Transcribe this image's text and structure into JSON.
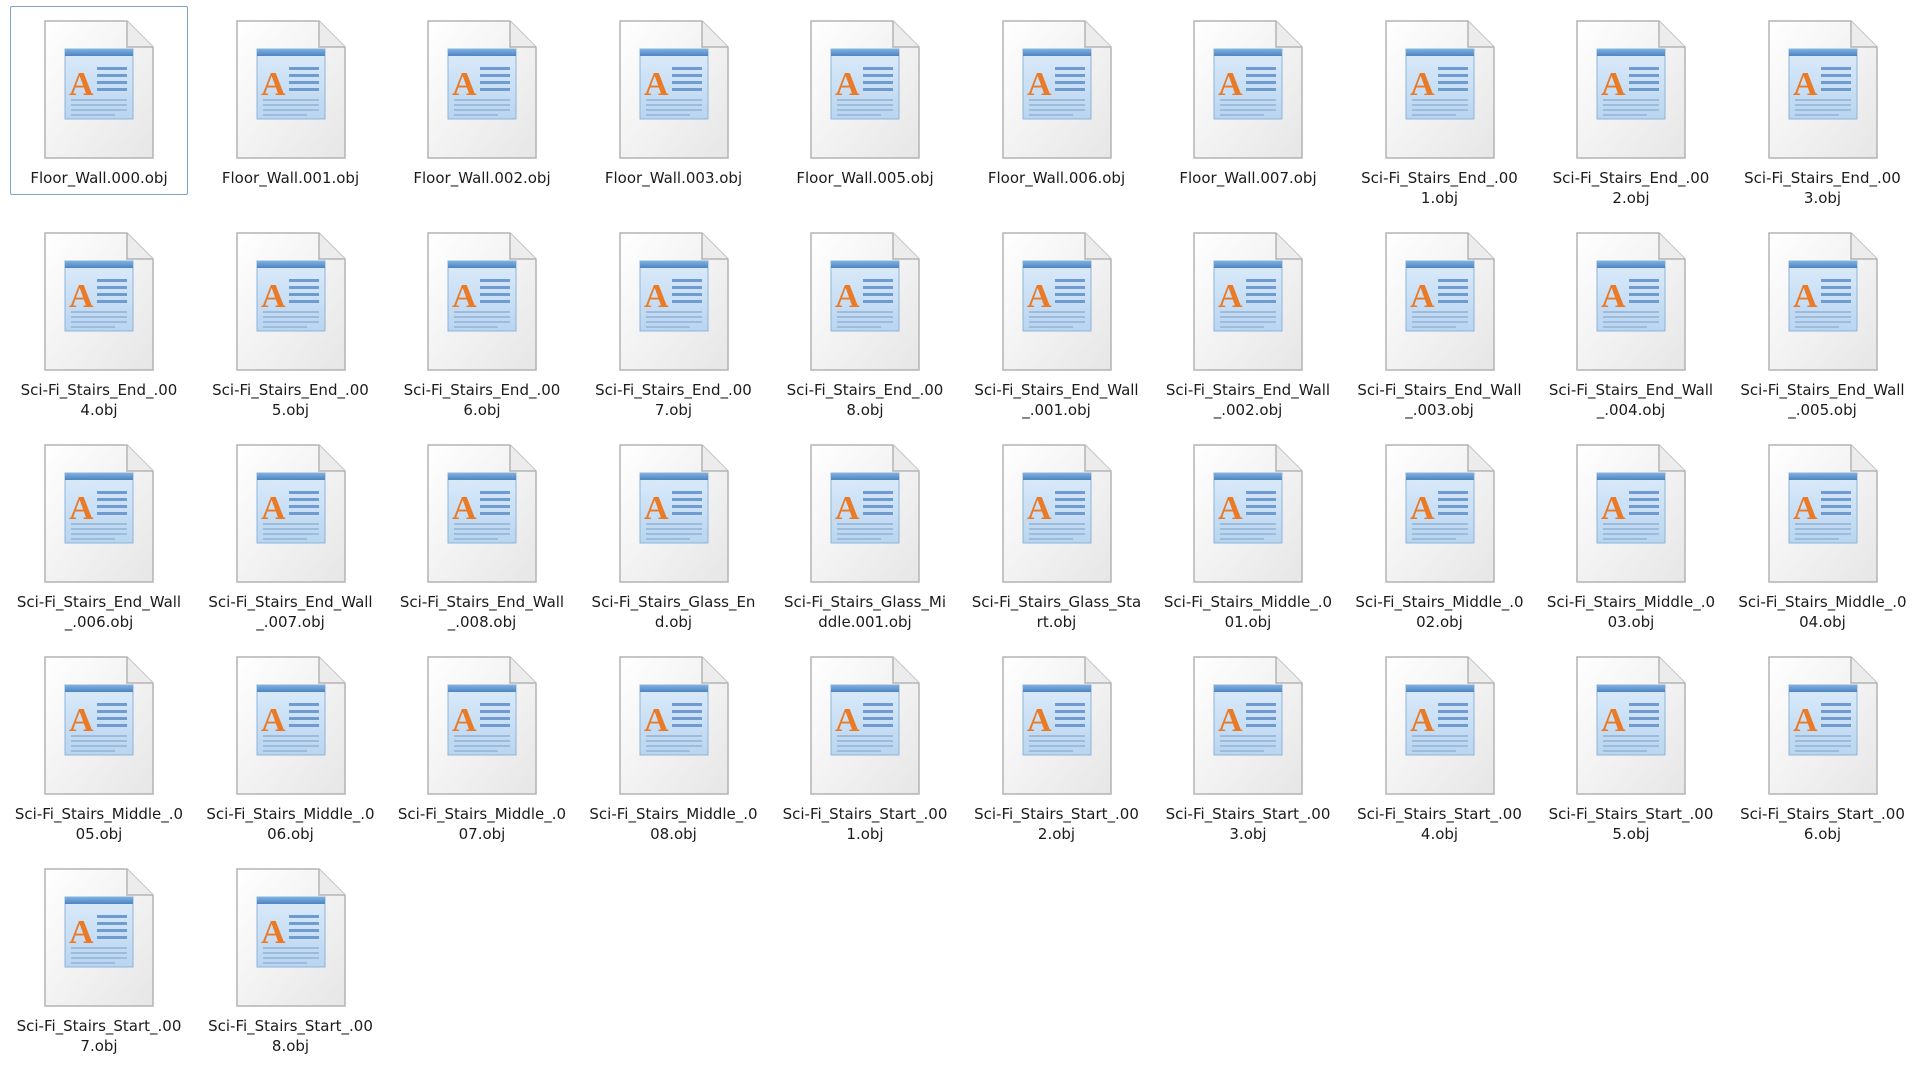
{
  "explorer": {
    "icon": "wordpad-document-icon",
    "files": [
      {
        "name": "Floor_Wall.000.obj",
        "selected": true
      },
      {
        "name": "Floor_Wall.001.obj"
      },
      {
        "name": "Floor_Wall.002.obj"
      },
      {
        "name": "Floor_Wall.003.obj"
      },
      {
        "name": "Floor_Wall.005.obj"
      },
      {
        "name": "Floor_Wall.006.obj"
      },
      {
        "name": "Floor_Wall.007.obj"
      },
      {
        "name": "Sci-Fi_Stairs_End_.001.obj"
      },
      {
        "name": "Sci-Fi_Stairs_End_.002.obj"
      },
      {
        "name": "Sci-Fi_Stairs_End_.003.obj"
      },
      {
        "name": "Sci-Fi_Stairs_End_.004.obj"
      },
      {
        "name": "Sci-Fi_Stairs_End_.005.obj"
      },
      {
        "name": "Sci-Fi_Stairs_End_.006.obj"
      },
      {
        "name": "Sci-Fi_Stairs_End_.007.obj"
      },
      {
        "name": "Sci-Fi_Stairs_End_.008.obj"
      },
      {
        "name": "Sci-Fi_Stairs_End_Wall_.001.obj"
      },
      {
        "name": "Sci-Fi_Stairs_End_Wall_.002.obj"
      },
      {
        "name": "Sci-Fi_Stairs_End_Wall_.003.obj"
      },
      {
        "name": "Sci-Fi_Stairs_End_Wall_.004.obj"
      },
      {
        "name": "Sci-Fi_Stairs_End_Wall_.005.obj"
      },
      {
        "name": "Sci-Fi_Stairs_End_Wall_.006.obj"
      },
      {
        "name": "Sci-Fi_Stairs_End_Wall_.007.obj"
      },
      {
        "name": "Sci-Fi_Stairs_End_Wall_.008.obj"
      },
      {
        "name": "Sci-Fi_Stairs_Glass_End.obj"
      },
      {
        "name": "Sci-Fi_Stairs_Glass_Middle.001.obj"
      },
      {
        "name": "Sci-Fi_Stairs_Glass_Start.obj"
      },
      {
        "name": "Sci-Fi_Stairs_Middle_.001.obj"
      },
      {
        "name": "Sci-Fi_Stairs_Middle_.002.obj"
      },
      {
        "name": "Sci-Fi_Stairs_Middle_.003.obj"
      },
      {
        "name": "Sci-Fi_Stairs_Middle_.004.obj"
      },
      {
        "name": "Sci-Fi_Stairs_Middle_.005.obj"
      },
      {
        "name": "Sci-Fi_Stairs_Middle_.006.obj"
      },
      {
        "name": "Sci-Fi_Stairs_Middle_.007.obj"
      },
      {
        "name": "Sci-Fi_Stairs_Middle_.008.obj"
      },
      {
        "name": "Sci-Fi_Stairs_Start_.001.obj"
      },
      {
        "name": "Sci-Fi_Stairs_Start_.002.obj"
      },
      {
        "name": "Sci-Fi_Stairs_Start_.003.obj"
      },
      {
        "name": "Sci-Fi_Stairs_Start_.004.obj"
      },
      {
        "name": "Sci-Fi_Stairs_Start_.005.obj"
      },
      {
        "name": "Sci-Fi_Stairs_Start_.006.obj"
      },
      {
        "name": "Sci-Fi_Stairs_Start_.007.obj"
      },
      {
        "name": "Sci-Fi_Stairs_Start_.008.obj"
      }
    ]
  },
  "colors": {
    "selection_border": "#7da2ce",
    "page_fill": "#f7f7f7",
    "page_stroke": "#b9b9b9",
    "header_blue": "#5b8fc6",
    "glyph_orange": "#ea7a26",
    "line_blue": "#6f9bd0"
  }
}
